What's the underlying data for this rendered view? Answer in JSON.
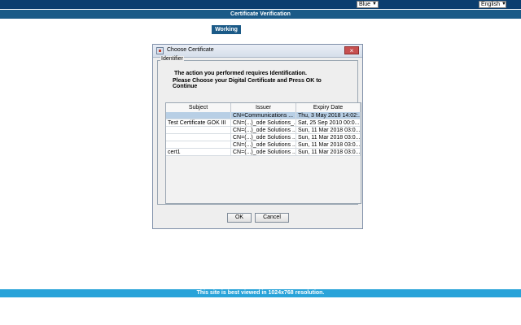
{
  "top": {
    "theme_select": {
      "value": "Blue"
    },
    "language_select": {
      "value": "English"
    }
  },
  "header": {
    "title": "Certificate Verification"
  },
  "status": {
    "working": "Working"
  },
  "dialog": {
    "title": "Choose Certificate",
    "group_label": "Identifier",
    "message_line1": "The action you performed requires Identification.",
    "message_line2": "Please Choose your Digital Certificate and Press OK to Continue",
    "table": {
      "headers": [
        "Subject",
        "Issuer",
        "Expiry Date"
      ],
      "rows": [
        {
          "subject": "",
          "issuer": "CN=Communications ...",
          "expiry": "Thu, 3 May 2018 14:02:..."
        },
        {
          "subject": "Test Certificate GOK III",
          "issuer": "CN=(...)_ode Solutions_...",
          "expiry": "Sat, 25 Sep 2010 00:0..."
        },
        {
          "subject": "",
          "issuer": "CN=(...)_ode Solutions ...",
          "expiry": "Sun, 11 Mar 2018 03:0..."
        },
        {
          "subject": "",
          "issuer": "CN=(...)_ode Solutions ...",
          "expiry": "Sun, 11 Mar 2018 03:0..."
        },
        {
          "subject": "",
          "issuer": "CN=(...)_ode Solutions ...",
          "expiry": "Sun, 11 Mar 2018 03:0..."
        },
        {
          "subject": "cert1",
          "issuer": "CN=(...)_ode Solutions ...",
          "expiry": "Sun, 11 Mar 2018 03:0..."
        }
      ],
      "selected_row_index": 0
    },
    "buttons": {
      "ok": "OK",
      "cancel": "Cancel"
    }
  },
  "footer": {
    "text": "This site is best viewed in 1024x768 resolution."
  }
}
